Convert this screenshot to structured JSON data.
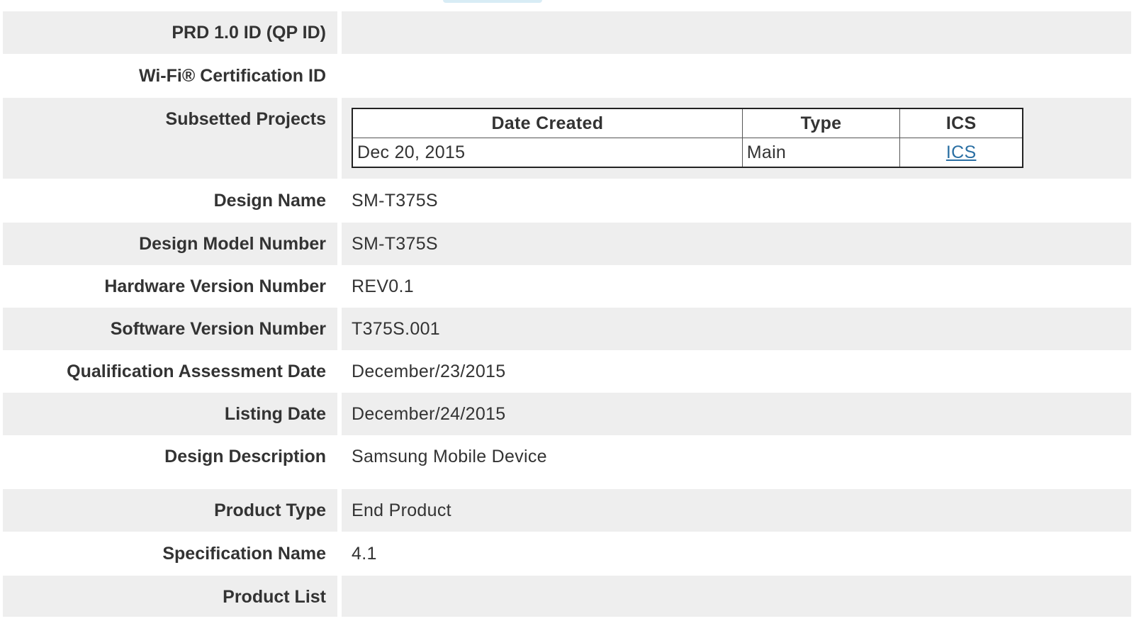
{
  "rows": [
    {
      "label": "PRD 1.0 ID (QP ID)",
      "value": ""
    },
    {
      "label": "Wi-Fi® Certification ID",
      "value": ""
    },
    {
      "label": "Subsetted Projects"
    },
    {
      "label": "Design Name",
      "value": "SM-T375S"
    },
    {
      "label": "Design Model Number",
      "value": "SM-T375S"
    },
    {
      "label": "Hardware Version Number",
      "value": "REV0.1"
    },
    {
      "label": "Software Version Number",
      "value": "T375S.001"
    },
    {
      "label": "Qualification Assessment Date",
      "value": "December/23/2015"
    },
    {
      "label": "Listing Date",
      "value": "December/24/2015"
    },
    {
      "label": "Design Description",
      "value": "Samsung Mobile Device"
    },
    {
      "label": "Product Type",
      "value": "End Product"
    },
    {
      "label": "Specification Name",
      "value": "4.1"
    },
    {
      "label": "Product List",
      "value": ""
    }
  ],
  "subsetted_projects": {
    "headers": {
      "date_created": "Date Created",
      "type": "Type",
      "ics": "ICS"
    },
    "rows": [
      {
        "date_created": "Dec 20, 2015",
        "type": "Main",
        "ics_link": "ICS"
      }
    ]
  }
}
